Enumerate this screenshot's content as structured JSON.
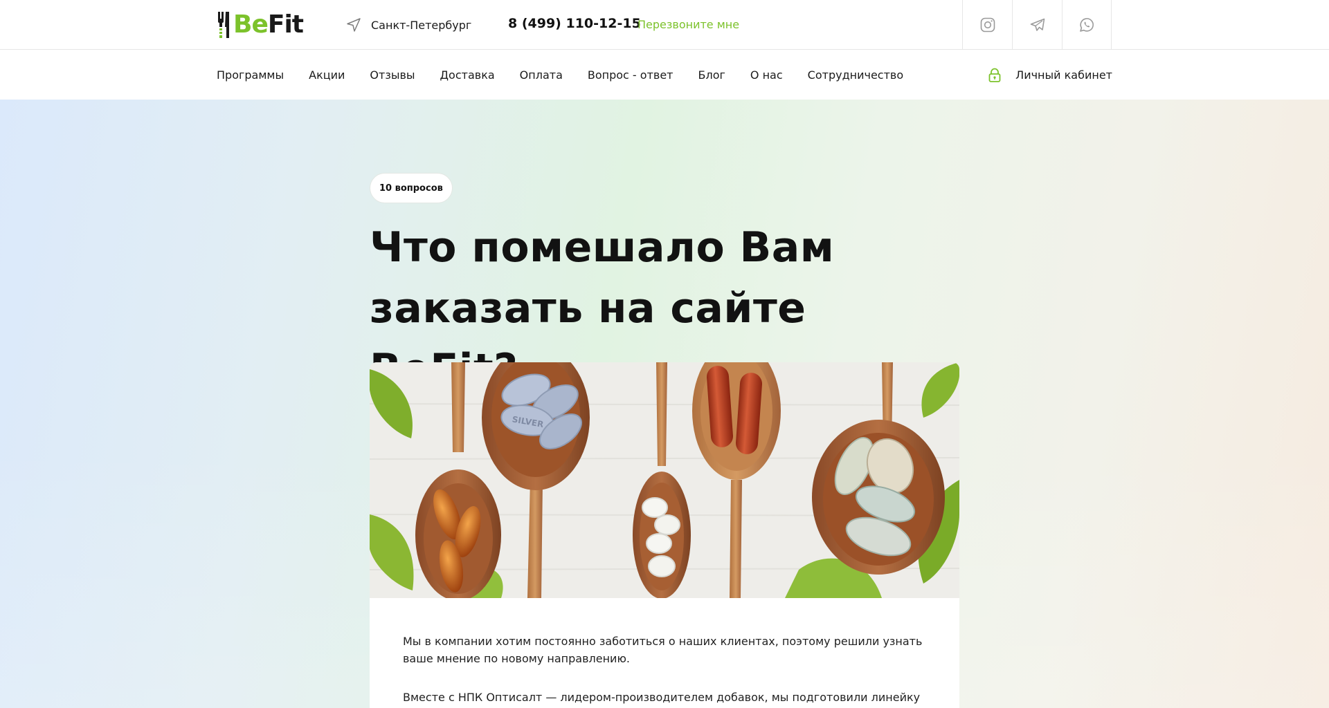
{
  "header": {
    "logo": {
      "part1": "Be",
      "part2": "Fit"
    },
    "city": "Санкт-Петербург",
    "phone": "8 (499) 110-12-15",
    "callback_label": "Перезвоните мне",
    "socials": [
      {
        "icon": "instagram-icon"
      },
      {
        "icon": "telegram-icon"
      },
      {
        "icon": "whatsapp-icon"
      }
    ]
  },
  "nav": {
    "items": [
      {
        "label": "Программы"
      },
      {
        "label": "Акции"
      },
      {
        "label": "Отзывы"
      },
      {
        "label": "Доставка"
      },
      {
        "label": "Оплата"
      },
      {
        "label": "Вопрос - ответ"
      },
      {
        "label": "Блог"
      },
      {
        "label": "О нас"
      },
      {
        "label": "Сотрудничество"
      }
    ],
    "account_label": "Личный кабинет"
  },
  "hero": {
    "badge": "10 вопросов",
    "title_line1": "Что помешало Вам",
    "title_line2": "заказать на сайте BeFit?",
    "photo_text": "SILVER"
  },
  "article": {
    "paragraph1": "Мы в компании хотим постоянно заботиться о наших клиентах, поэтому решили узнать ваше мнение по новому направлению.",
    "paragraph2": "Вместе с НПК Оптисалт — лидером-производителем добавок, мы подготовили линейку"
  },
  "colors": {
    "accent": "#7cc22b",
    "text": "#1a1a1a",
    "border": "#e6e6e6"
  }
}
